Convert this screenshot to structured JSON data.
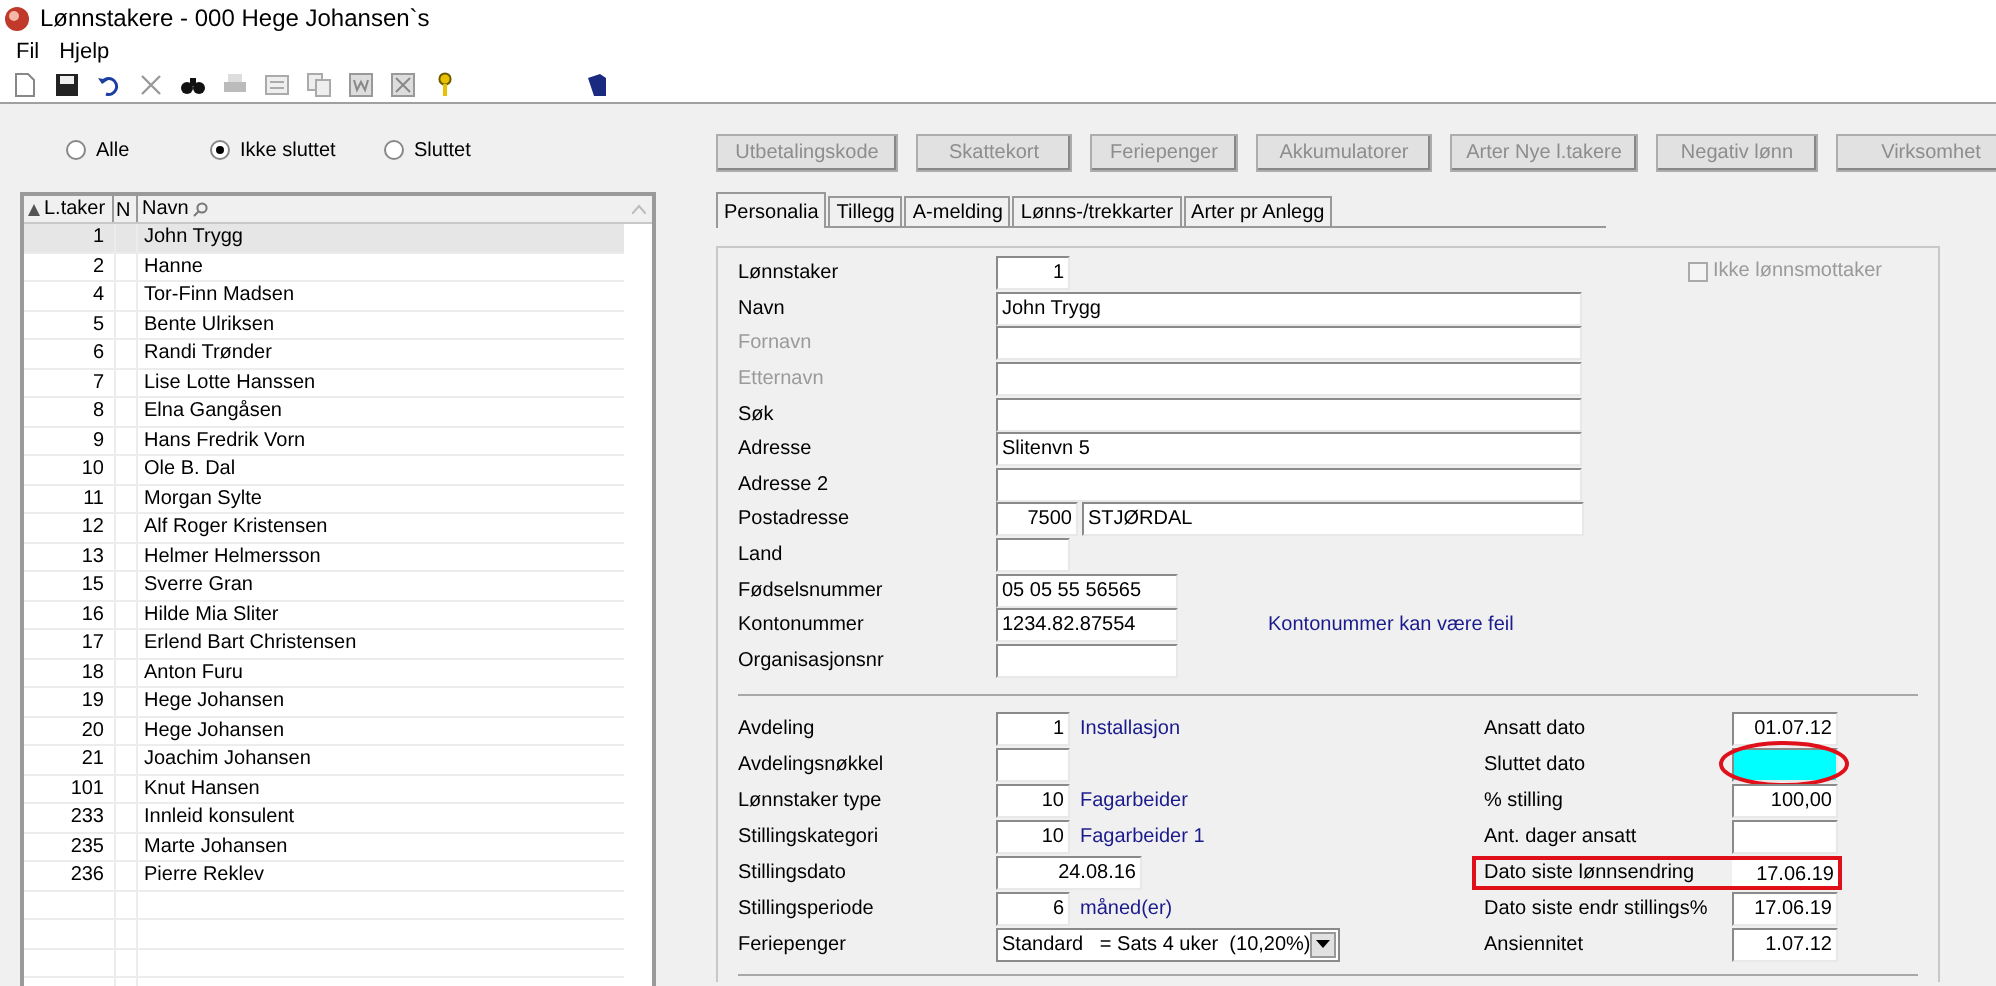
{
  "window": {
    "title": "Lønnstakere - 000 Hege Johansen`s"
  },
  "menu": [
    "Fil",
    "Hjelp"
  ],
  "filter_radios": [
    {
      "label": "Alle",
      "selected": false
    },
    {
      "label": "Ikke sluttet",
      "selected": true
    },
    {
      "label": "Sluttet",
      "selected": false
    }
  ],
  "action_buttons": [
    {
      "label": "Utbetalingskode",
      "disabled": true
    },
    {
      "label": "Skattekort",
      "disabled": true
    },
    {
      "label": "Feriepenger",
      "disabled": true
    },
    {
      "label": "Akkumulatorer",
      "disabled": true
    },
    {
      "label": "Arter Nye l.takere",
      "disabled": true
    },
    {
      "label": "Negativ lønn",
      "disabled": true
    },
    {
      "label": "Virksomhet",
      "disabled": true
    }
  ],
  "employee_list": {
    "columns": [
      "L.taker",
      "N",
      "Navn"
    ],
    "rows": [
      {
        "number": "1",
        "name": "John Trygg",
        "selected": true
      },
      {
        "number": "2",
        "name": "Hanne",
        "selected": false
      },
      {
        "number": "4",
        "name": "Tor-Finn Madsen",
        "selected": false
      },
      {
        "number": "5",
        "name": "Bente Ulriksen",
        "selected": false
      },
      {
        "number": "6",
        "name": "Randi Trønder",
        "selected": false
      },
      {
        "number": "7",
        "name": "Lise Lotte Hanssen",
        "selected": false
      },
      {
        "number": "8",
        "name": "Elna Gangåsen",
        "selected": false
      },
      {
        "number": "9",
        "name": "Hans Fredrik Vorn",
        "selected": false
      },
      {
        "number": "10",
        "name": "Ole B. Dal",
        "selected": false
      },
      {
        "number": "11",
        "name": "Morgan Sylte",
        "selected": false
      },
      {
        "number": "12",
        "name": "Alf Roger Kristensen",
        "selected": false
      },
      {
        "number": "13",
        "name": "Helmer Helmersson",
        "selected": false
      },
      {
        "number": "15",
        "name": "Sverre Gran",
        "selected": false
      },
      {
        "number": "16",
        "name": "Hilde Mia Sliter",
        "selected": false
      },
      {
        "number": "17",
        "name": "Erlend Bart Christensen",
        "selected": false
      },
      {
        "number": "18",
        "name": "Anton Furu",
        "selected": false
      },
      {
        "number": "19",
        "name": "Hege Johansen",
        "selected": false
      },
      {
        "number": "20",
        "name": "Hege Johansen",
        "selected": false
      },
      {
        "number": "21",
        "name": "Joachim Johansen",
        "selected": false
      },
      {
        "number": "101",
        "name": "Knut Hansen",
        "selected": false
      },
      {
        "number": "233",
        "name": "Innleid konsulent",
        "selected": false
      },
      {
        "number": "235",
        "name": "Marte Johansen",
        "selected": false
      },
      {
        "number": "236",
        "name": "Pierre Reklev",
        "selected": false
      }
    ]
  },
  "tabs": [
    {
      "label": "Personalia",
      "selected": true
    },
    {
      "label": "Tillegg",
      "selected": false
    },
    {
      "label": "A-melding",
      "selected": false
    },
    {
      "label": "Lønns-/trekkarter",
      "selected": false
    },
    {
      "label": "Arter pr Anlegg",
      "selected": false
    }
  ],
  "ikke_lonnsmottaker": {
    "label": "Ikke lønnsmottaker",
    "checked": false,
    "disabled": true
  },
  "personal_fields": [
    {
      "label": "Lønnstaker",
      "kind": "number",
      "value": "1",
      "disabled": false
    },
    {
      "label": "Navn",
      "kind": "wide",
      "value": "John Trygg",
      "disabled": false
    },
    {
      "label": "Fornavn",
      "kind": "wide",
      "disabled": true
    },
    {
      "label": "Etternavn",
      "kind": "wide",
      "disabled": true
    },
    {
      "label": "Søk",
      "kind": "wide",
      "disabled": false
    },
    {
      "label": "Adresse",
      "kind": "wide",
      "value": "Slitenvn 5",
      "disabled": false
    },
    {
      "label": "Adresse 2",
      "kind": "wide",
      "disabled": false
    },
    {
      "label": "Postadresse",
      "kind": "postal",
      "value": "7500",
      "value_2": "STJØRDAL",
      "disabled": false
    },
    {
      "label": "Land",
      "kind": "short",
      "disabled": false
    },
    {
      "label": "Fødselsnummer",
      "kind": "medium",
      "value": "05 05 55 56565",
      "disabled": false
    },
    {
      "label": "Kontonummer",
      "kind": "medium",
      "value": "1234.82.87554",
      "note": "Kontonummer kan være feil",
      "disabled": false
    },
    {
      "label": "Organisasjonsnr",
      "kind": "medium",
      "disabled": false
    }
  ],
  "job_fields": [
    {
      "label": "Avdeling",
      "kind": "code",
      "value": "1",
      "note": "Installasjon"
    },
    {
      "label": "Avdelingsnøkkel",
      "kind": "code"
    },
    {
      "label": "Lønnstaker type",
      "kind": "code",
      "value": "10",
      "note": "Fagarbeider"
    },
    {
      "label": "Stillingskategori",
      "kind": "code",
      "value": "10",
      "note": "Fagarbeider 1"
    },
    {
      "label": "Stillingsdato",
      "kind": "date",
      "value": "24.08.16"
    },
    {
      "label": "Stillingsperiode",
      "kind": "code",
      "value": "6",
      "note": "måned(er)"
    },
    {
      "label": "Feriepenger",
      "kind": "select",
      "value": "Standard   = Sats 4 uker  (10,20%)"
    }
  ],
  "date_fields": [
    {
      "label": "Ansatt dato",
      "value": "01.07.12",
      "focused": false,
      "circled": false,
      "boxed": false
    },
    {
      "label": "Sluttet dato",
      "focused": true,
      "circled": true,
      "boxed": false
    },
    {
      "label": "% stilling",
      "value": "100,00",
      "focused": false,
      "circled": false,
      "boxed": false
    },
    {
      "label": "Ant. dager ansatt",
      "focused": false,
      "circled": false,
      "boxed": false
    },
    {
      "label": "Dato siste lønnsendring",
      "value": "17.06.19",
      "focused": false,
      "circled": false,
      "boxed": true
    },
    {
      "label": "Dato siste endr stillings%",
      "value": "17.06.19",
      "focused": false,
      "circled": false,
      "boxed": false
    },
    {
      "label": "Ansiennitet",
      "value": "1.07.12",
      "focused": false,
      "circled": false,
      "boxed": false
    }
  ]
}
